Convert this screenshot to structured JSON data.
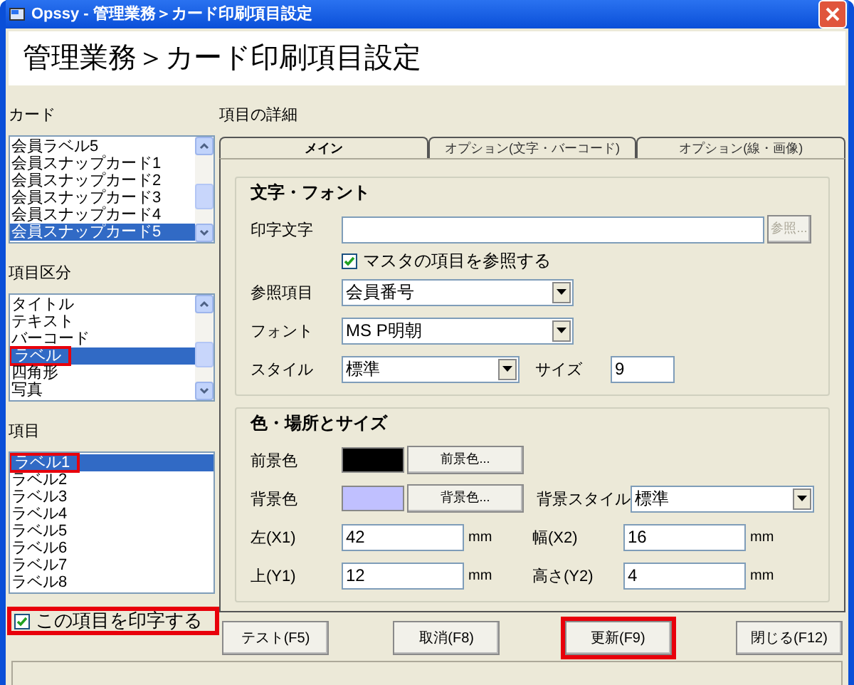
{
  "window": {
    "title": "Opssy - 管理業務＞カード印刷項目設定"
  },
  "header": "管理業務＞カード印刷項目設定",
  "card_list": {
    "label": "カード",
    "items": [
      {
        "text": "会員ラベル5",
        "selected": false,
        "highlighted": false
      },
      {
        "text": "会員スナップカード1",
        "selected": false,
        "highlighted": false
      },
      {
        "text": "会員スナップカード2",
        "selected": false,
        "highlighted": false
      },
      {
        "text": "会員スナップカード3",
        "selected": false,
        "highlighted": false
      },
      {
        "text": "会員スナップカード4",
        "selected": false,
        "highlighted": false
      },
      {
        "text": "会員スナップカード5",
        "selected": true,
        "highlighted": false
      }
    ]
  },
  "category_list": {
    "label": "項目区分",
    "items": [
      {
        "text": "タイトル",
        "selected": false,
        "highlighted": false
      },
      {
        "text": "テキスト",
        "selected": false,
        "highlighted": false
      },
      {
        "text": "バーコード",
        "selected": false,
        "highlighted": false
      },
      {
        "text": "ラベル",
        "selected": true,
        "highlighted": true
      },
      {
        "text": "四角形",
        "selected": false,
        "highlighted": false
      },
      {
        "text": "写真",
        "selected": false,
        "highlighted": false
      }
    ]
  },
  "item_list": {
    "label": "項目",
    "items": [
      {
        "text": "ラベル1",
        "selected": true,
        "highlighted": true
      },
      {
        "text": "ラベル2",
        "selected": false,
        "highlighted": false
      },
      {
        "text": "ラベル3",
        "selected": false,
        "highlighted": false
      },
      {
        "text": "ラベル4",
        "selected": false,
        "highlighted": false
      },
      {
        "text": "ラベル5",
        "selected": false,
        "highlighted": false
      },
      {
        "text": "ラベル6",
        "selected": false,
        "highlighted": false
      },
      {
        "text": "ラベル7",
        "selected": false,
        "highlighted": false
      },
      {
        "text": "ラベル8",
        "selected": false,
        "highlighted": false
      }
    ]
  },
  "print_checkbox": {
    "label": "この項目を印字する",
    "checked": true,
    "highlighted": true
  },
  "details": {
    "label": "項目の詳細",
    "tabs": [
      {
        "label": "メイン",
        "selected": true
      },
      {
        "label": "オプション(文字・バーコード)",
        "selected": false
      },
      {
        "label": "オプション(線・画像)",
        "selected": false
      }
    ],
    "font_group": {
      "title": "文字・フォント",
      "print_text": {
        "label": "印字文字",
        "browse_button": "参照...",
        "browse_disabled": true
      },
      "master_checkbox": {
        "label": "マスタの項目を参照する",
        "checked": true
      },
      "reference_item": {
        "label": "参照項目",
        "value": "会員番号"
      },
      "font": {
        "label": "フォント",
        "value": "MS P明朝"
      },
      "style": {
        "label": "スタイル",
        "value": "標準"
      },
      "size": {
        "label": "サイズ",
        "value": "9"
      }
    },
    "position_group": {
      "title": "色・場所とサイズ",
      "foreground": {
        "label": "前景色",
        "color": "#000000",
        "button": "前景色..."
      },
      "background": {
        "label": "背景色",
        "color": "#c0c0ff",
        "button": "背景色..."
      },
      "background_style": {
        "label": "背景スタイル",
        "value": "標準"
      },
      "fields": [
        {
          "label": "左(X1)",
          "value": "42",
          "unit": "mm"
        },
        {
          "label": "幅(X2)",
          "value": "16",
          "unit": "mm"
        },
        {
          "label": "上(Y1)",
          "value": "12",
          "unit": "mm"
        },
        {
          "label": "高さ(Y2)",
          "value": "4",
          "unit": "mm"
        }
      ]
    }
  },
  "buttons": [
    {
      "label": "テスト(F5)",
      "highlighted": false
    },
    {
      "label": "取消(F8)",
      "highlighted": false
    },
    {
      "label": "更新(F9)",
      "highlighted": true
    },
    {
      "label": "閉じる(F12)",
      "highlighted": false
    }
  ]
}
